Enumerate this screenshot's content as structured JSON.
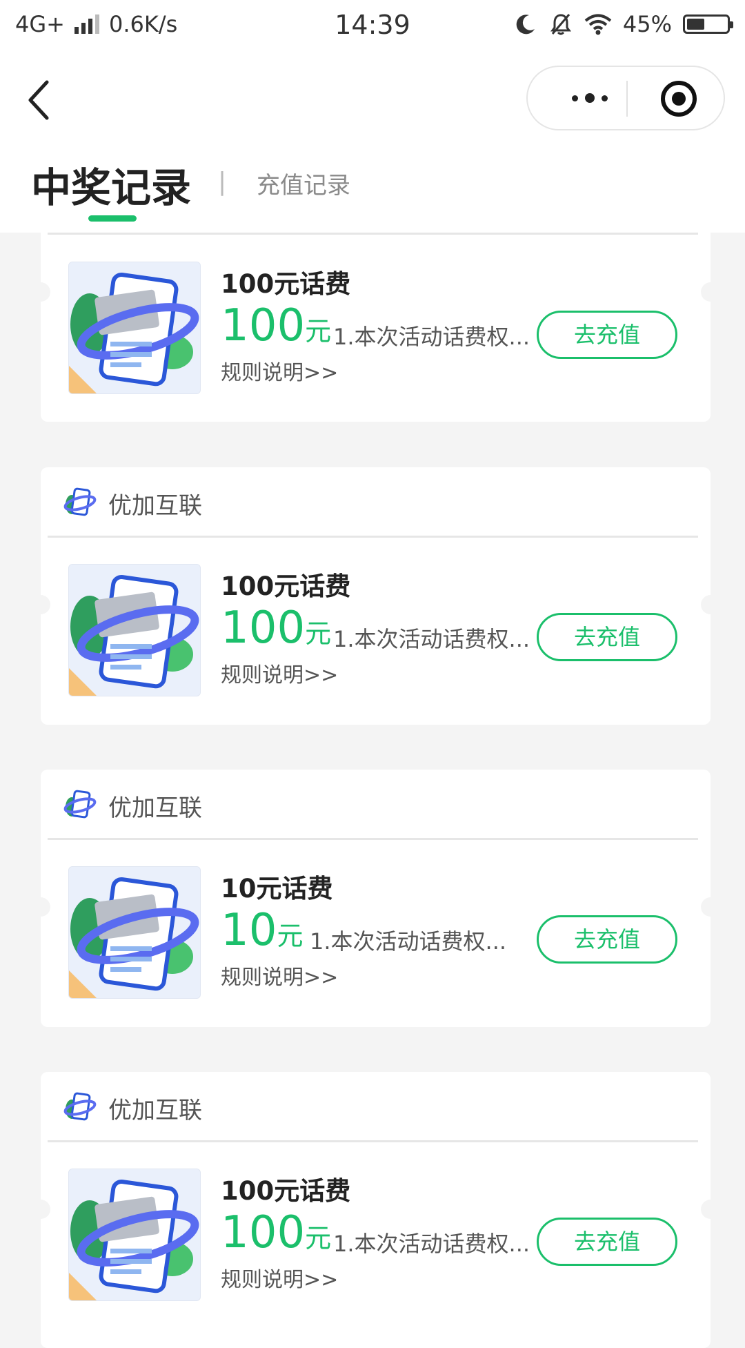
{
  "status_bar": {
    "network": "4G+",
    "speed": "0.6K/s",
    "time": "14:39",
    "battery": "45%",
    "battery_level": 0.45
  },
  "header": {
    "tab_active": "中奖记录",
    "tab_separator": "|",
    "tab_inactive": "充值记录"
  },
  "colors": {
    "accent": "#1bbf6b"
  },
  "cards": [
    {
      "merchant": "",
      "title": "100元话费",
      "amount": "100",
      "unit": "元",
      "desc": "1.本次活动话费权...",
      "rules": "规则说明>>",
      "button": "去充值"
    },
    {
      "merchant": "优加互联",
      "title": "100元话费",
      "amount": "100",
      "unit": "元",
      "desc": "1.本次活动话费权...",
      "rules": "规则说明>>",
      "button": "去充值"
    },
    {
      "merchant": "优加互联",
      "title": "10元话费",
      "amount": "10",
      "unit": "元",
      "desc": "1.本次活动话费权...",
      "rules": "规则说明>>",
      "button": "去充值"
    },
    {
      "merchant": "优加互联",
      "title": "100元话费",
      "amount": "100",
      "unit": "元",
      "desc": "1.本次活动话费权...",
      "rules": "规则说明>>",
      "button": "去充值"
    }
  ]
}
